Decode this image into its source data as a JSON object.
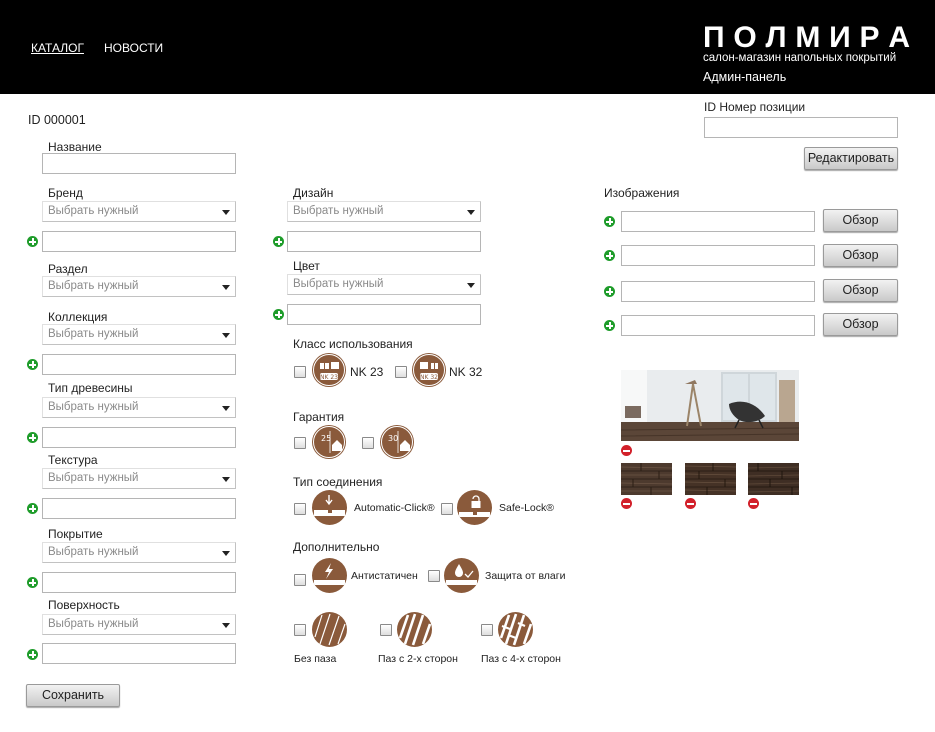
{
  "header": {
    "nav": [
      "КАТАЛОГ",
      "НОВОСТИ"
    ],
    "logo_letters": [
      "П",
      "О",
      "Л",
      "М",
      "И",
      "Р",
      "А"
    ],
    "logo_subtitle": "салон-магазин напольных покрытий",
    "admin_label": "Админ-панель"
  },
  "record": {
    "id_label": "ID 000001",
    "position_label": "ID Номер позиции",
    "position_value": "",
    "edit_button": "Редактировать"
  },
  "form": {
    "name_label": "Название",
    "placeholder": "Выбрать нужный",
    "fields_left": [
      "Бренд",
      "Раздел",
      "Коллекция",
      "Тип древесины",
      "Текстура",
      "Покрытие",
      "Поверхность"
    ],
    "fields_mid": [
      "Дизайн",
      "Цвет"
    ],
    "usage_class_label": "Класс использования",
    "usage_classes": [
      "NK 23",
      "NK 32"
    ],
    "guarantee_label": "Гарантия",
    "guarantee_years": [
      "25",
      "30"
    ],
    "connection_label": "Тип соединения",
    "connections": [
      "Automatic-Click®",
      "Safe-Lock®"
    ],
    "extra_label": "Дополнительно",
    "extras": [
      "Антистатичен",
      "Защита от влаги"
    ],
    "grooves": [
      "Без паза",
      "Паз с 2-х сторон",
      "Паз с 4-х сторон"
    ],
    "save_button": "Сохранить"
  },
  "images": {
    "label": "Изображения",
    "browse_label": "Обзор",
    "rows": [
      "",
      "",
      "",
      ""
    ]
  },
  "colors": {
    "header_bg": "#000000",
    "icon_brown": "#8a5a3b",
    "add_green": "#1e9c2a",
    "remove_red": "#d2202a"
  }
}
